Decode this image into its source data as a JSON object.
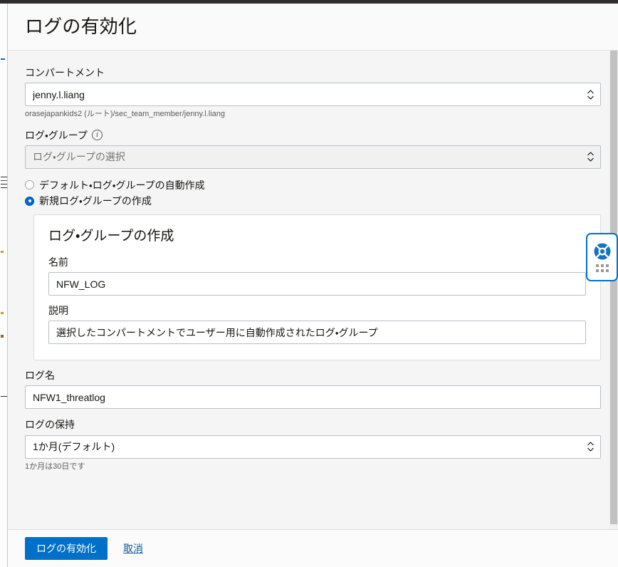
{
  "window": {
    "title": "ログの有効化"
  },
  "compartment": {
    "label": "コンパートメント",
    "value": "jenny.l.liang",
    "path_helper": "orasejapankids2 (ルート)/sec_team_member/jenny.l.liang",
    "dropdown_icon": "select-stepper-icon"
  },
  "log_group": {
    "label": "ログ・グループ",
    "info_icon": "info-circle-icon",
    "placeholder": "ログ・グループの選択",
    "value": "",
    "disabled": true,
    "dropdown_icon": "select-stepper-icon",
    "options": [
      {
        "label": "デフォルト・ログ・グループの自動作成",
        "selected": false
      },
      {
        "label": "新規ログ・グループの作成",
        "selected": true
      }
    ]
  },
  "create_log_group_card": {
    "title": "ログ・グループの作成",
    "name_label": "名前",
    "name_value": "NFW_LOG",
    "description_label": "説明",
    "description_value": "選択したコンパートメントでユーザー用に自動作成されたログ・グループ"
  },
  "log_name": {
    "label": "ログ名",
    "value": "NFW1_threatlog"
  },
  "log_retention": {
    "label": "ログの保持",
    "value": "1か月(デフォルト)",
    "helper": "1か月は30日です",
    "dropdown_icon": "select-stepper-icon"
  },
  "footer": {
    "submit_label": "ログの有効化",
    "cancel_label": "取消"
  },
  "help_widget": {
    "icon": "life-preserver-icon",
    "handle_icon": "drag-handle-dots-icon"
  },
  "colors": {
    "accent": "#0070c9",
    "link": "#125e9e",
    "panel_bg": "#f5f5f5",
    "header_bg": "#fafafa",
    "card_bg": "#ffffff",
    "text": "#161513",
    "helper_text": "#5c5c5c",
    "border": "#b9bfc7"
  }
}
